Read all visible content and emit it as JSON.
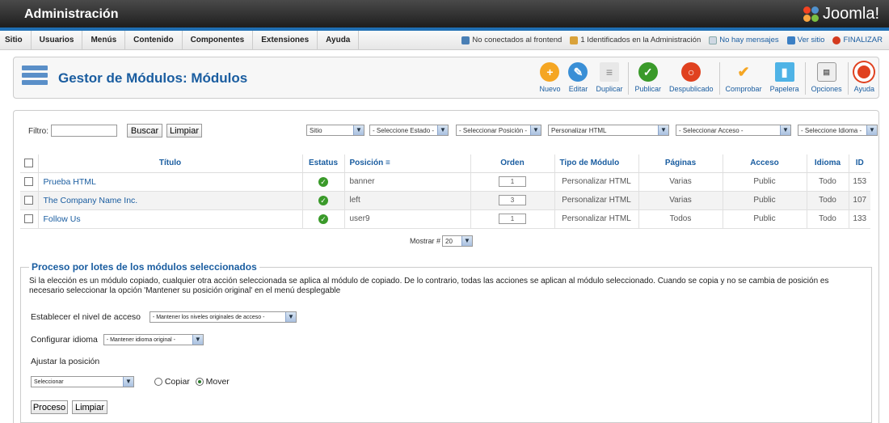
{
  "header": {
    "title": "Administración",
    "logo": "Joomla!"
  },
  "menu": [
    "Sitio",
    "Usuarios",
    "Menús",
    "Contenido",
    "Componentes",
    "Extensiones",
    "Ayuda"
  ],
  "status": {
    "frontend": "No conectados al frontend",
    "admins": "1 Identificados en la Administración",
    "messages": "No hay mensajes",
    "view_site": "Ver sitio",
    "logout": "FINALIZAR"
  },
  "page": {
    "title": "Gestor de Módulos: Módulos"
  },
  "toolbar": [
    "Nuevo",
    "Editar",
    "Duplicar",
    "Publicar",
    "Despublicado",
    "Comprobar",
    "Papelera",
    "Opciones",
    "Ayuda"
  ],
  "filters": {
    "label": "Filtro:",
    "search_btn": "Buscar",
    "clear_btn": "Limpiar",
    "site": "Sitio",
    "state": "- Seleccione Estado -",
    "position": "- Seleccionar Posición -",
    "type": "Personalizar HTML",
    "access": "- Seleccionar Acceso -",
    "language": "- Seleccione Idioma -"
  },
  "table": {
    "headers": [
      "Título",
      "Estatus",
      "Posición",
      "Orden",
      "Tipo de Módulo",
      "Páginas",
      "Acceso",
      "Idioma",
      "ID"
    ],
    "rows": [
      {
        "title": "Prueba HTML",
        "position": "banner",
        "order": "1",
        "type": "Personalizar HTML",
        "pages": "Varias",
        "access": "Public",
        "language": "Todo",
        "id": "153"
      },
      {
        "title": "The Company Name Inc.",
        "position": "left",
        "order": "3",
        "type": "Personalizar HTML",
        "pages": "Varias",
        "access": "Public",
        "language": "Todo",
        "id": "107"
      },
      {
        "title": "Follow Us",
        "position": "user9",
        "order": "1",
        "type": "Personalizar HTML",
        "pages": "Todos",
        "access": "Public",
        "language": "Todo",
        "id": "133"
      }
    ]
  },
  "pagination": {
    "label": "Mostrar #",
    "value": "20"
  },
  "batch": {
    "legend": "Proceso por lotes de los módulos seleccionados",
    "description": "Si la elección es un módulo copiado, cualquier otra acción seleccionada se aplica al módulo de copiado. De lo contrario, todas las acciones se aplican al módulo seleccionado. Cuando se copia y no se cambia de posición es necesario seleccionar la opción 'Mantener su posición original' en el menú desplegable",
    "access_label": "Establecer el nivel de acceso",
    "access_value": "- Mantener los niveles originales de acceso -",
    "lang_label": "Configurar idioma",
    "lang_value": "- Mantener idioma original -",
    "position_label": "Ajustar la posición",
    "position_value": "Seleccionar",
    "copy": "Copiar",
    "move": "Mover",
    "process_btn": "Proceso",
    "clear_btn": "Limpiar"
  }
}
